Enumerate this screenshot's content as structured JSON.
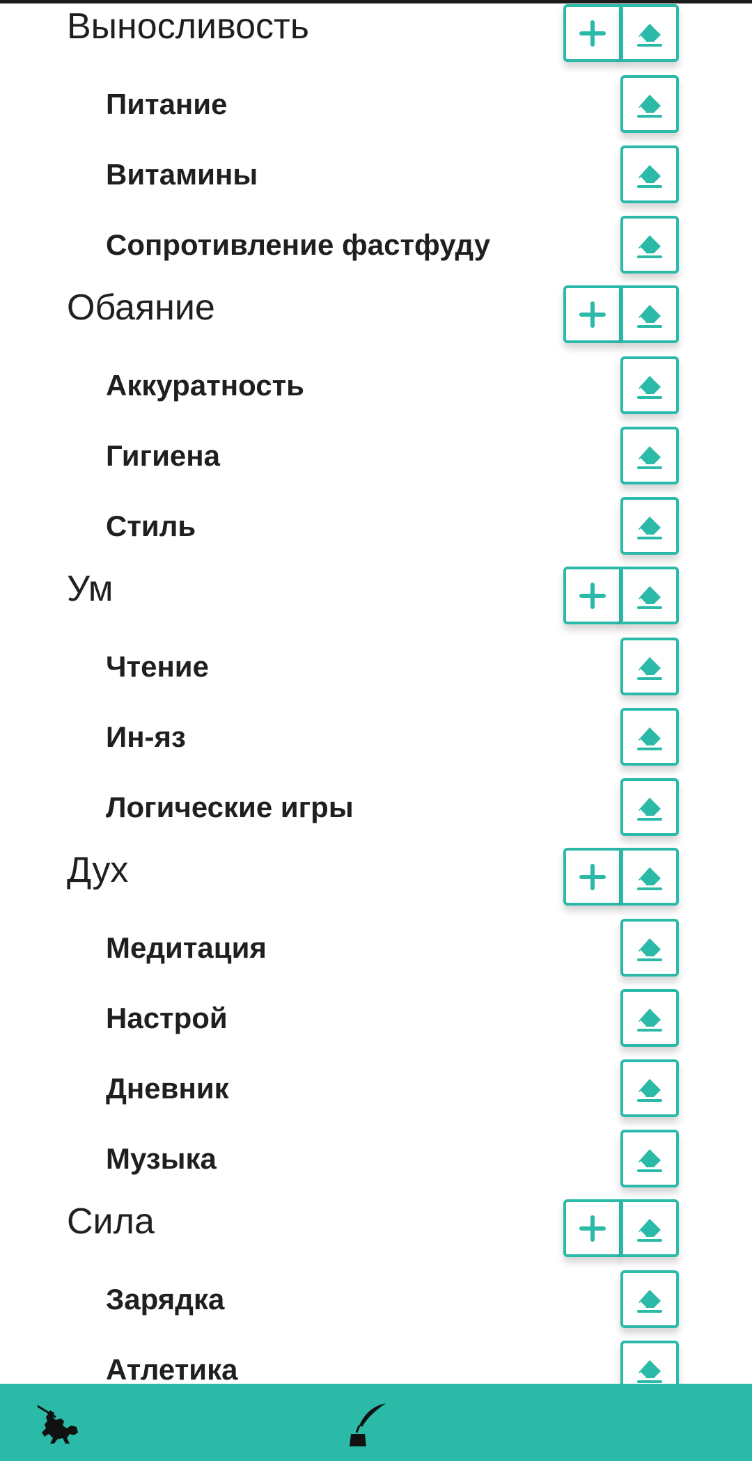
{
  "accent_color": "#2bb9a8",
  "categories": [
    {
      "title": "Выносливость",
      "items": [
        "Питание",
        "Витамины",
        "Сопротивление фастфуду"
      ]
    },
    {
      "title": "Обаяние",
      "items": [
        "Аккуратность",
        "Гигиена",
        "Стиль"
      ]
    },
    {
      "title": "Ум",
      "items": [
        "Чтение",
        "Ин-яз",
        "Логические игры"
      ]
    },
    {
      "title": "Дух",
      "items": [
        "Медитация",
        "Настрой",
        "Дневник",
        "Музыка"
      ]
    },
    {
      "title": "Сила",
      "items": [
        "Зарядка",
        "Атлетика"
      ]
    }
  ],
  "icons": {
    "add": "plus-icon",
    "erase": "eraser-icon",
    "nav_left": "knight-icon",
    "nav_right": "quill-inkwell-icon"
  }
}
